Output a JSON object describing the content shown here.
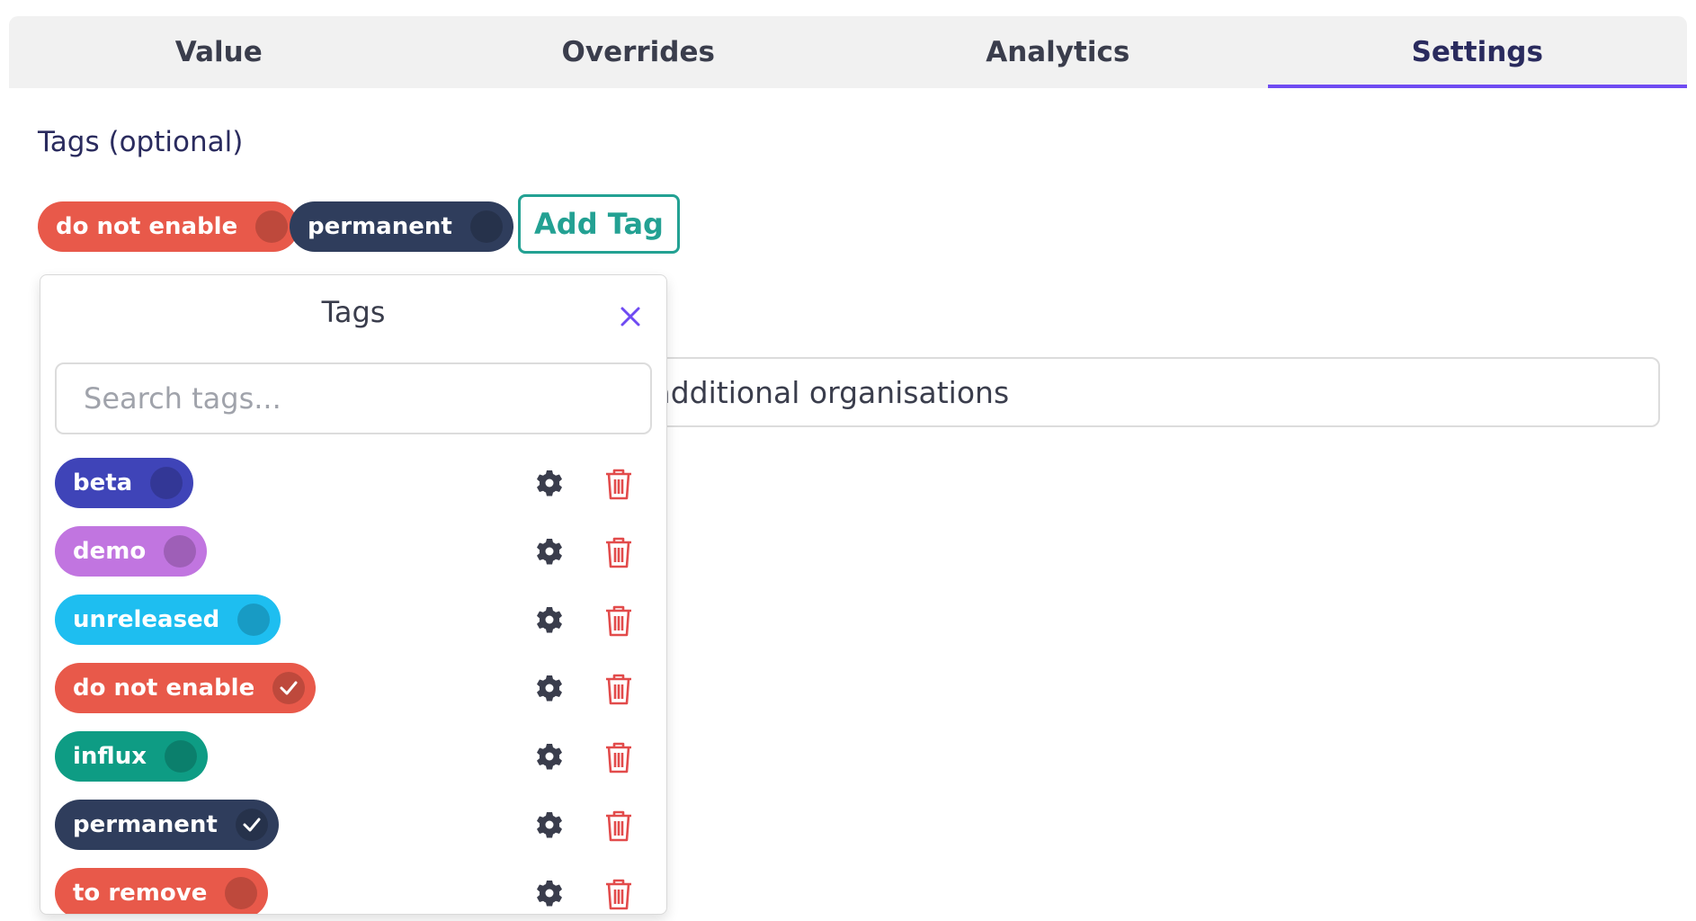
{
  "tabs": [
    {
      "label": "Value",
      "active": false
    },
    {
      "label": "Overrides",
      "active": false
    },
    {
      "label": "Analytics",
      "active": false
    },
    {
      "label": "Settings",
      "active": true
    }
  ],
  "tags_section": {
    "label": "Tags (optional)",
    "selected": [
      {
        "label": "do not enable",
        "color": "#e8594a"
      },
      {
        "label": "permanent",
        "color": "#2f3d5c"
      }
    ],
    "add_button": "Add Tag"
  },
  "background_input": {
    "value": "ng any additional organisations"
  },
  "popover": {
    "title": "Tags",
    "search_placeholder": "Search tags...",
    "items": [
      {
        "label": "beta",
        "color": "#3f44b8",
        "selected": false
      },
      {
        "label": "demo",
        "color": "#c175e0",
        "selected": false
      },
      {
        "label": "unreleased",
        "color": "#1ebef0",
        "selected": false
      },
      {
        "label": "do not enable",
        "color": "#e8594a",
        "selected": true
      },
      {
        "label": "influx",
        "color": "#0e9c84",
        "selected": false
      },
      {
        "label": "permanent",
        "color": "#2f3d5c",
        "selected": true
      },
      {
        "label": "to remove",
        "color": "#e8594a",
        "selected": false
      }
    ]
  },
  "colors": {
    "accent": "#6f4bf2",
    "add_tag": "#23a193",
    "delete": "#e24b4b",
    "gear": "#3a3d4c"
  },
  "icons": [
    "close-icon",
    "gear-icon",
    "trash-icon",
    "check-icon"
  ]
}
